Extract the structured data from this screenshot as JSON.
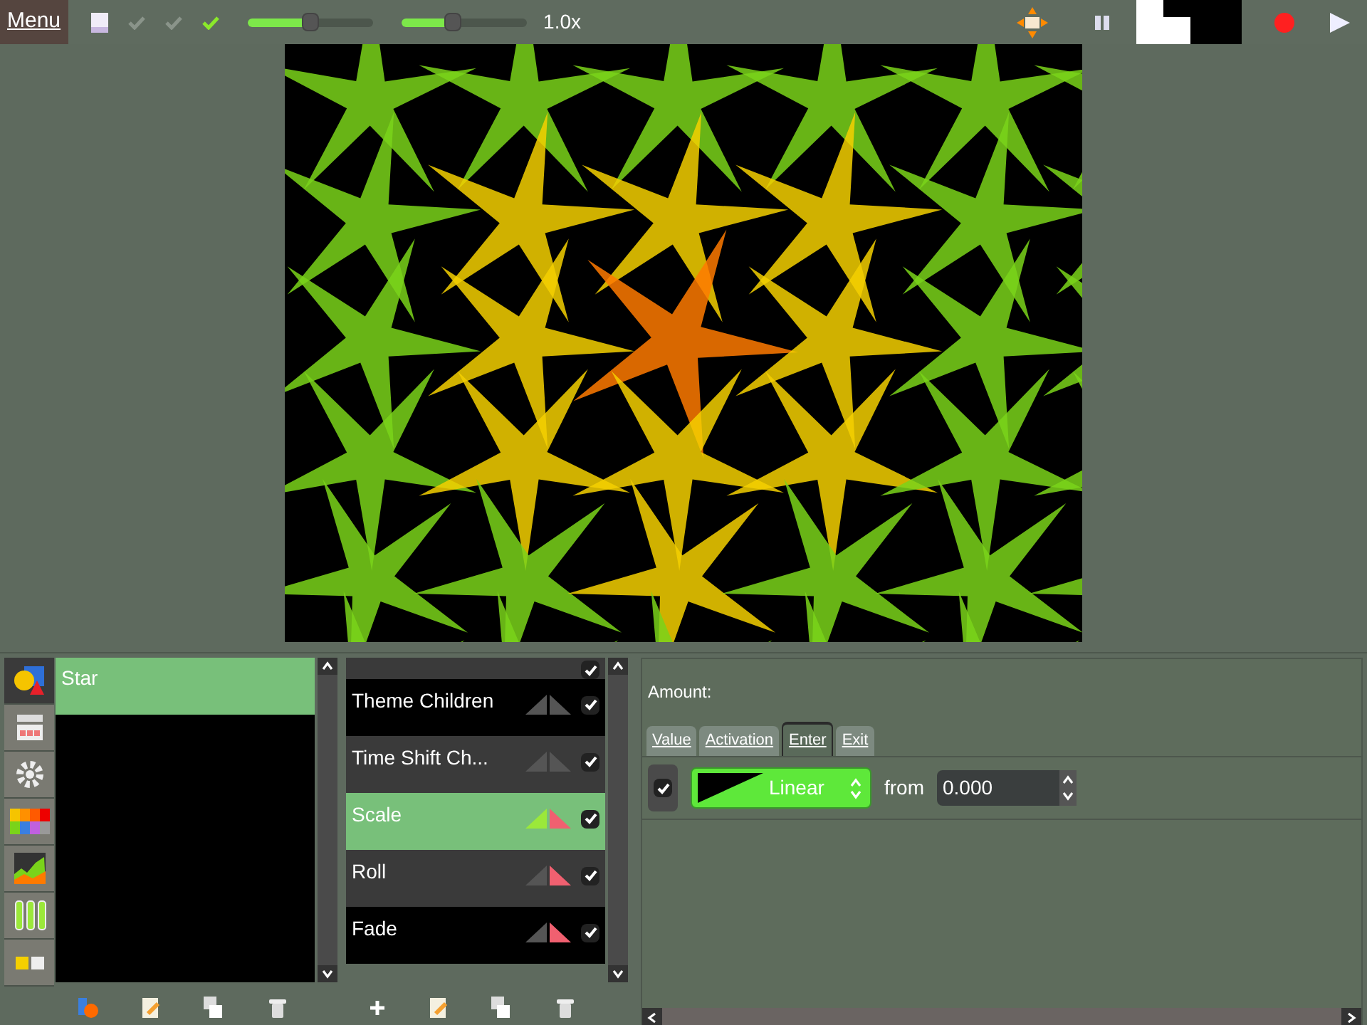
{
  "toolbar": {
    "menu": "Menu",
    "checks": [
      {
        "on": false
      },
      {
        "on": false
      },
      {
        "on": true
      }
    ],
    "sliders": [
      {
        "level": 0.5
      },
      {
        "level": 0.42
      }
    ],
    "speed": "1.0x",
    "recording": true
  },
  "layers": {
    "items": [
      {
        "label": "Star",
        "selected": true
      }
    ]
  },
  "side_tabs": [
    {
      "selected": true
    },
    {
      "selected": false
    },
    {
      "selected": false
    },
    {
      "selected": false
    },
    {
      "selected": false
    },
    {
      "selected": false
    },
    {
      "selected": false
    }
  ],
  "effects": {
    "partial_row": {
      "checked": true
    },
    "items": [
      {
        "label": "Theme Children",
        "selected": false,
        "enter": false,
        "exit": false,
        "checked": true
      },
      {
        "label": "Time Shift Ch...",
        "selected": false,
        "enter": false,
        "exit": false,
        "checked": true
      },
      {
        "label": "Scale",
        "selected": true,
        "enter": true,
        "exit": true,
        "checked": true
      },
      {
        "label": "Roll",
        "selected": false,
        "enter": false,
        "exit": true,
        "checked": true
      },
      {
        "label": "Fade",
        "selected": false,
        "enter": false,
        "exit": true,
        "checked": true
      }
    ]
  },
  "properties": {
    "title": "Amount:",
    "tabs": [
      {
        "label": "Value",
        "selected": false
      },
      {
        "label": "Activation",
        "selected": false
      },
      {
        "label": "Enter",
        "selected": true
      },
      {
        "label": "Exit",
        "selected": false
      }
    ],
    "enabled": true,
    "curve": "Linear",
    "from_label": "from",
    "from_value": "0.000"
  }
}
